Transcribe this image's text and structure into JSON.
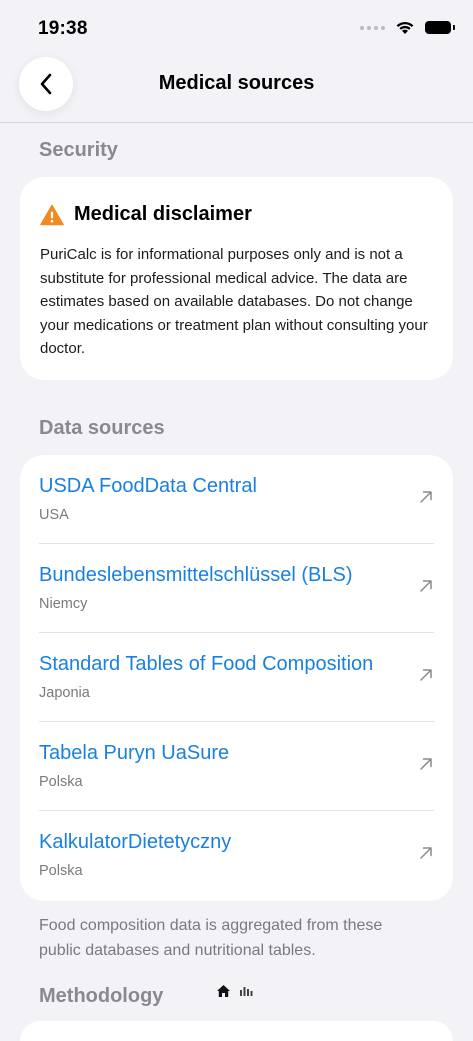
{
  "status_bar": {
    "time": "19:38"
  },
  "nav": {
    "title": "Medical sources"
  },
  "sections": {
    "security": "Security",
    "data_sources": "Data sources",
    "methodology": "Methodology"
  },
  "disclaimer": {
    "title": "Medical disclaimer",
    "body": "PuriCalc is for informational purposes only and is not a substitute for professional medical advice. The data are estimates based on available databases. Do not change your medications or treatment plan without consulting your doctor."
  },
  "sources": [
    {
      "name": "USDA FoodData Central",
      "country": "USA"
    },
    {
      "name": "Bundeslebensmittelschlüssel (BLS)",
      "country": "Niemcy"
    },
    {
      "name": "Standard Tables of Food Composition",
      "country": "Japonia"
    },
    {
      "name": "Tabela Puryn UaSure",
      "country": "Polska"
    },
    {
      "name": "KalkulatorDietetyczny",
      "country": "Polska"
    }
  ],
  "footer_note": "Food composition data is aggregated from these public databases and nutritional tables.",
  "colors": {
    "link": "#1a80e0",
    "warning": "#f08a24",
    "background": "#f2f2f7"
  },
  "icons": [
    "back-chevron-icon",
    "warning-icon",
    "external-link-icon",
    "home-icon",
    "chart-icon"
  ]
}
